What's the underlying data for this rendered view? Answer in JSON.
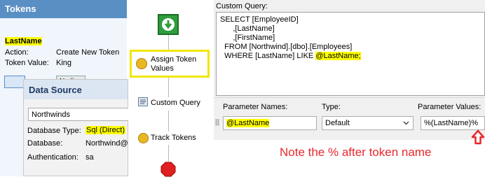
{
  "tokens_panel": {
    "header": "Tokens",
    "token_name": "LastName",
    "action_label": "Action:",
    "action_value": "Create New Token",
    "token_value_label": "Token Value:",
    "token_value_value": "King",
    "btn_partial_1": "",
    "btn_partial_2": "Nodi"
  },
  "data_source": {
    "header": "Data Source",
    "source_select": "Northwinds",
    "db_type_label": "Database Type:",
    "db_type_value": "Sql (Direct)",
    "database_label": "Database:",
    "database_value": "Northwind@",
    "auth_label": "Authentication:",
    "auth_value": "sa"
  },
  "flow": {
    "steps": [
      "Assign Token Values",
      "Custom Query",
      "Track Tokens"
    ],
    "assign_line1": "Assign Token",
    "assign_line2": "Values"
  },
  "custom_query": {
    "title": "Custom Query:",
    "lines": [
      "SELECT [EmployeeID]",
      "      ,[LastName]",
      "      ,[FirstName]",
      "  FROM [Northwind].[dbo].[Employees]",
      "  WHERE [LastName] LIKE "
    ],
    "param_highlight": "@LastName;"
  },
  "parameters": {
    "names_label": "Parameter Names:",
    "type_label": "Type:",
    "values_label": "Parameter Values:",
    "name_value": "@LastName",
    "type_value": "Default",
    "param_value": "%(LastName)%"
  },
  "note": "Note the % after token name",
  "colors": {
    "highlight": "#ffff00",
    "note_red": "#e8282c",
    "header_blue": "#5a8fc4"
  }
}
